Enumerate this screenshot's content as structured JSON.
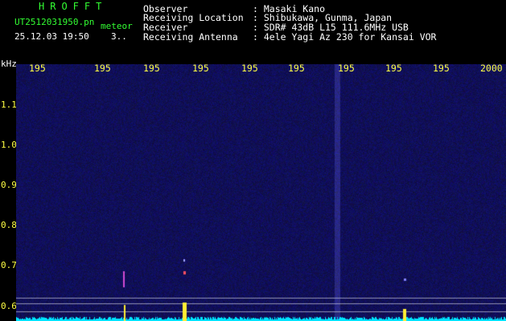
{
  "header": {
    "logo": "HROFFT",
    "filename": "UT2512031950.pn",
    "file_tag": "meteor",
    "datetime": "25.12.03 19:50",
    "count": "3.."
  },
  "info": [
    {
      "label": "Observer",
      "value": ": Masaki Kano"
    },
    {
      "label": "Receiving Location",
      "value": ": Shibukawa, Gunma, Japan"
    },
    {
      "label": "Receiver",
      "value": ": SDR# 43dB L15 111.6MHz USB"
    },
    {
      "label": "Receiving Antenna",
      "value": ": 4ele Yagi Az 230 for Kansai VOR"
    }
  ],
  "axis": {
    "unit": "kHz",
    "y_ticks": [
      "1.1",
      "1.0",
      "0.9",
      "0.8",
      "0.7",
      "0.6"
    ],
    "x_ticks": [
      "195",
      "195",
      "195",
      "195",
      "195",
      "195",
      "195",
      "195",
      "195",
      "2000"
    ]
  },
  "colors": {
    "text_green": "#33ff33",
    "axis_yellow": "#ffff44",
    "background": "#000000",
    "spectrum_base": "#0d0c55",
    "spectrum_trace": "#00e5ff"
  }
}
